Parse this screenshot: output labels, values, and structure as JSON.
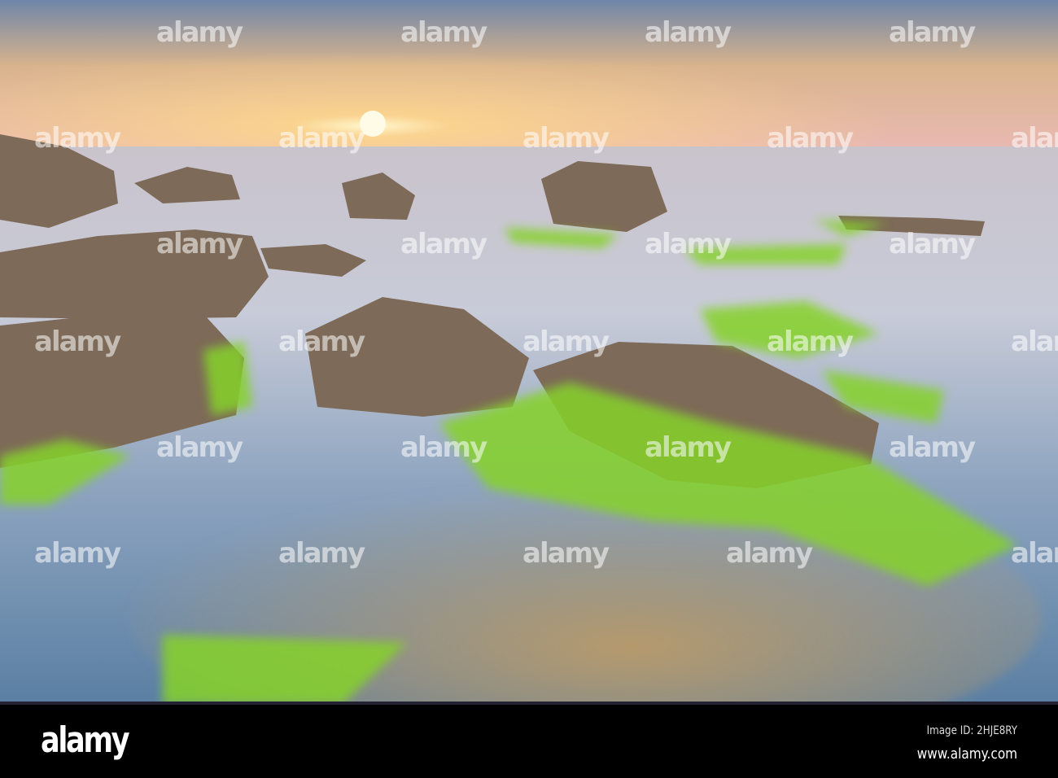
{
  "watermark": {
    "text": "alamy"
  },
  "footer": {
    "logo": "alamy",
    "image_id": "Image ID: 2HJE8RY",
    "url": "www.alamy.com"
  }
}
